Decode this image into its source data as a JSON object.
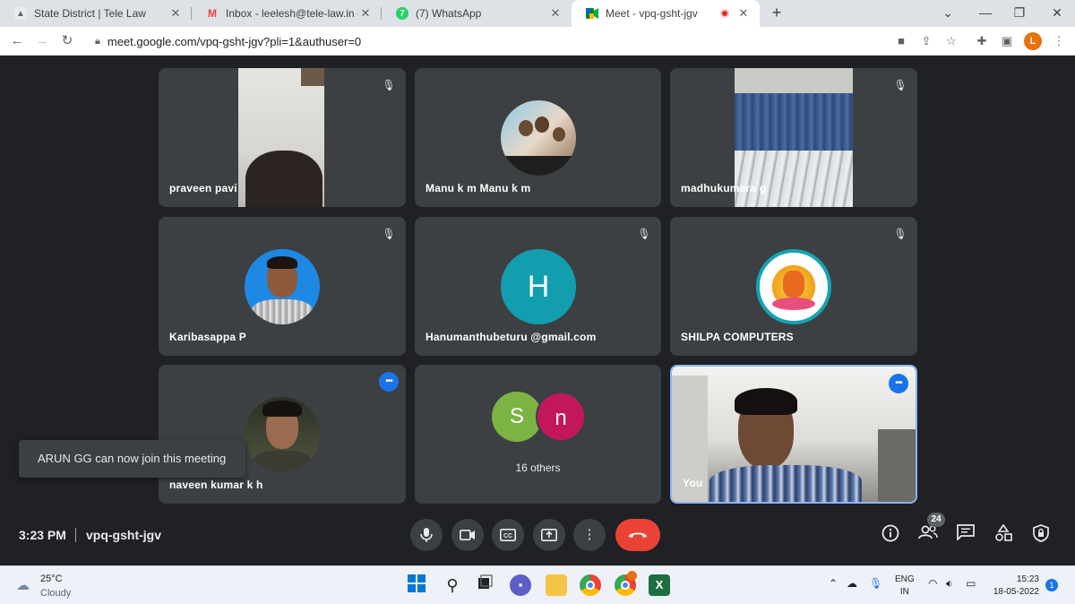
{
  "tabs": [
    {
      "title": "State District | Tele Law",
      "icon": "document-icon"
    },
    {
      "title": "Inbox - leelesh@tele-law.in - CSC",
      "icon": "gmail-icon"
    },
    {
      "title": "(7) WhatsApp",
      "icon": "whatsapp-icon",
      "badge": "7"
    },
    {
      "title": "Meet - vpq-gsht-jgv",
      "icon": "meet-icon"
    }
  ],
  "address": {
    "url": "meet.google.com/vpq-gsht-jgv?pli=1&authuser=0"
  },
  "profile": {
    "initial": "L"
  },
  "participants": [
    {
      "name": "praveen pavi",
      "muted": true
    },
    {
      "name": "Manu k m Manu k m",
      "muted": false
    },
    {
      "name": "madhukumara g",
      "muted": true
    },
    {
      "name": "Karibasappa P",
      "muted": true
    },
    {
      "name": "Hanumanthubeturu @gmail.com",
      "muted": true,
      "initial": "H"
    },
    {
      "name": "SHILPA COMPUTERS",
      "muted": true
    },
    {
      "name": "naveen kumar k h",
      "speaking": true
    },
    {
      "name": "",
      "others": "16 others",
      "initials": [
        "S",
        "n"
      ]
    },
    {
      "name": "You",
      "speaking": true
    }
  ],
  "toast": {
    "message": "ARUN GG can now join this meeting"
  },
  "meeting": {
    "time": "3:23 PM",
    "code": "vpq-gsht-jgv",
    "people_count": "24"
  },
  "taskbar": {
    "weather_temp": "25°C",
    "weather_cond": "Cloudy",
    "lang_1": "ENG",
    "lang_2": "IN",
    "clock_time": "15:23",
    "clock_date": "18-05-2022",
    "notifications": "1"
  },
  "colors": {
    "meet_bg": "#202124",
    "tile_bg": "#3c4043",
    "end_call": "#ea4335",
    "speaking": "#1a73e8",
    "avatar_h": "#129eaf",
    "avatar_s": "#7cb342",
    "avatar_n": "#c2185b"
  }
}
